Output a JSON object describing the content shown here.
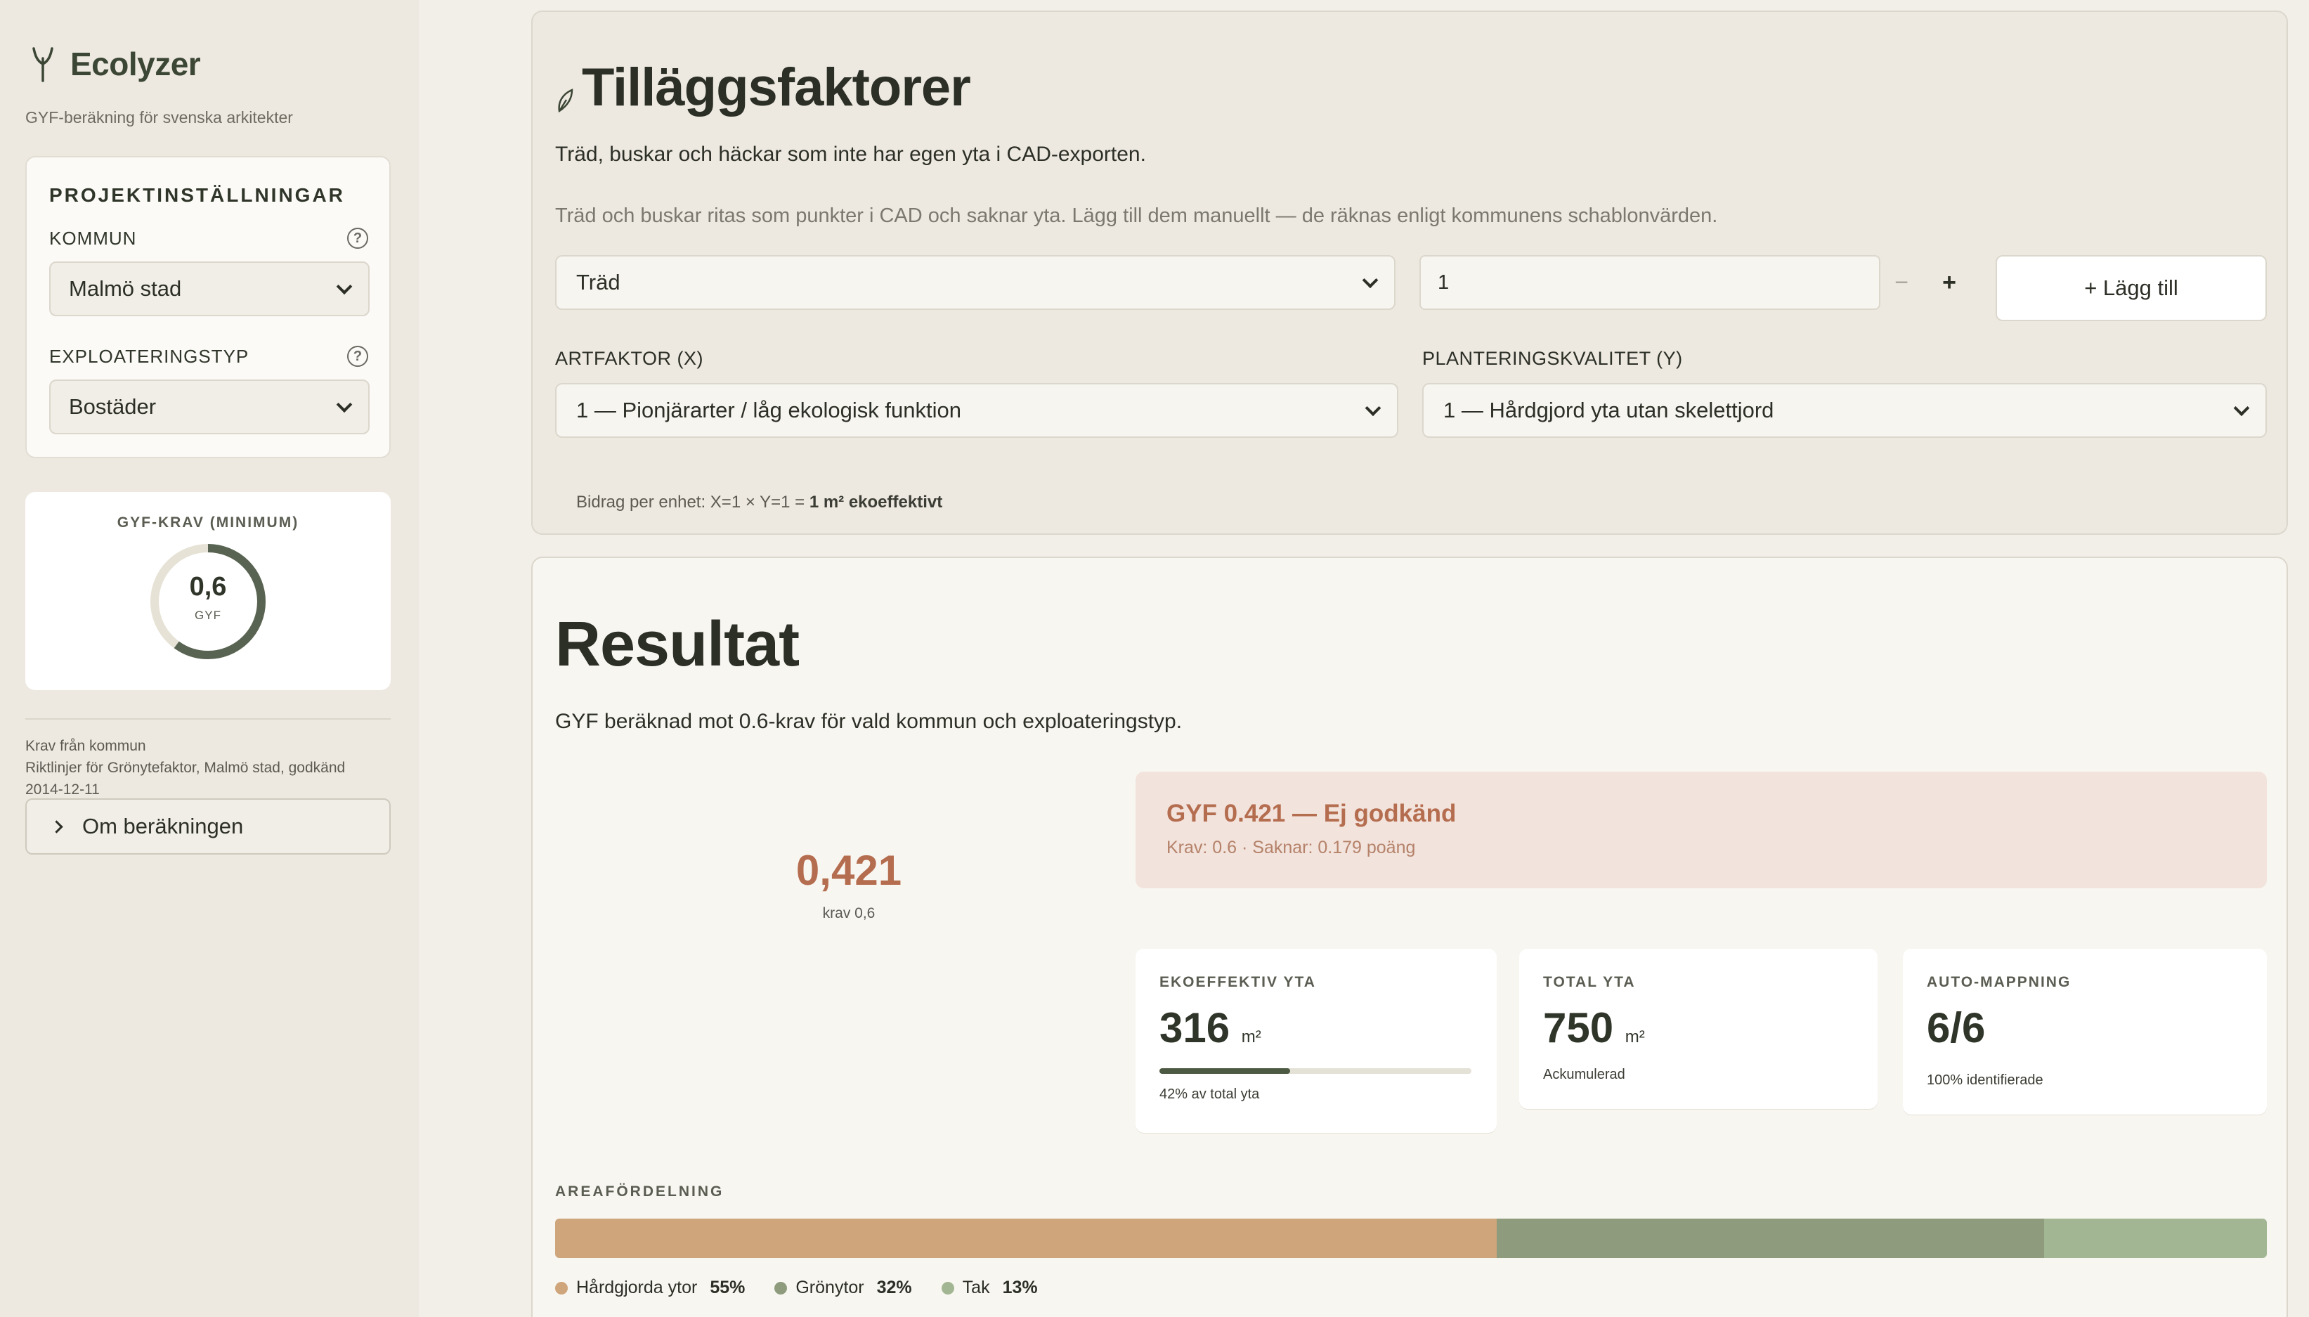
{
  "app": {
    "name": "Ecolyzer",
    "subtitle": "GYF-beräkning för svenska arkitekter"
  },
  "settings": {
    "title": "PROJEKTINSTÄLLNINGAR",
    "kommun_label": "KOMMUN",
    "kommun_value": "Malmö stad",
    "exploatering_label": "EXPLOATERINGSTYP",
    "exploatering_value": "Bostäder",
    "help_glyph": "?"
  },
  "gyf_req": {
    "title": "GYF-KRAV (MINIMUM)",
    "value": "0,6",
    "unit": "GYF",
    "fraction": 0.6
  },
  "source": {
    "line1": "Krav från kommun",
    "line2": "Riktlinjer för Grönytefaktor, Malmö stad, godkänd",
    "line3": "2014-12-11"
  },
  "about": {
    "label": "Om beräkningen"
  },
  "tillagg": {
    "title": "Tilläggsfaktorer",
    "desc": "Träd, buskar och häckar som inte har egen yta i CAD-exporten.",
    "hint": "Träd och buskar ritas som punkter i CAD och saknar yta. Lägg till dem manuellt — de räknas enligt kommunens schablonvärden.",
    "type_value": "Träd",
    "quantity": "1",
    "minus": "−",
    "plus": "+",
    "add_label": "+ Lägg till",
    "artfaktor_label": "ARTFAKTOR (X)",
    "artfaktor_value": "1 — Pionjärarter / låg ekologisk funktion",
    "planteringskvalitet_label": "PLANTERINGSKVALITET (Y)",
    "planteringskvalitet_value": "1 — Hårdgjord yta utan skelettjord",
    "contrib_prefix": "Bidrag per enhet: X=1 × Y=1 = ",
    "contrib_value": "1 m² ekoeffektivt"
  },
  "result": {
    "title": "Resultat",
    "subtitle": "GYF beräknad mot 0.6-krav för vald kommun och exploateringstyp.",
    "score": "0,421",
    "krav": "krav 0,6",
    "alert_title": "GYF 0.421 — Ej godkänd",
    "alert_sub": "Krav: 0.6 · Saknar: 0.179 poäng",
    "colors": {
      "fail": "#b56d4f",
      "alert_bg": "#f2e3dc"
    }
  },
  "stats": {
    "eko": {
      "label": "EKOEFFEKTIV YTA",
      "value": "316",
      "unit": "m²",
      "note": "42% av total yta",
      "fraction": 0.42
    },
    "total": {
      "label": "TOTAL YTA",
      "value": "750",
      "unit": "m²",
      "note": "Ackumulerad"
    },
    "auto": {
      "label": "AUTO-MAPPNING",
      "value": "6/6",
      "note": "100% identifierade"
    }
  },
  "area": {
    "label": "AREAFÖRDELNING",
    "segments": [
      {
        "name": "Hårdgjorda ytor",
        "pct_label": "55%",
        "fraction": 0.55,
        "color": "#cfa57b"
      },
      {
        "name": "Grönytor",
        "pct_label": "32%",
        "fraction": 0.32,
        "color": "#8e9c7d"
      },
      {
        "name": "Tak",
        "pct_label": "13%",
        "fraction": 0.13,
        "color": "#a3b693"
      }
    ]
  }
}
